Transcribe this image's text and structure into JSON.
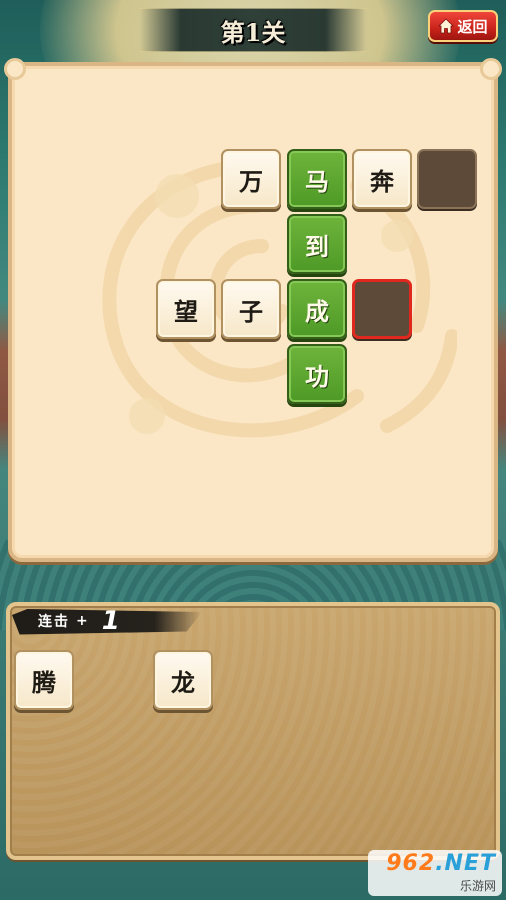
{
  "header": {
    "level_title": "第1关",
    "back_label": "返回"
  },
  "board": {
    "tiles": [
      {
        "char": "万",
        "state": "plain"
      },
      {
        "char": "马",
        "state": "green"
      },
      {
        "char": "奔",
        "state": "plain"
      },
      {
        "char": "",
        "state": "empty"
      },
      {
        "char": "到",
        "state": "green"
      },
      {
        "char": "望",
        "state": "plain"
      },
      {
        "char": "子",
        "state": "plain"
      },
      {
        "char": "成",
        "state": "green"
      },
      {
        "char": "",
        "state": "empty-selected"
      },
      {
        "char": "功",
        "state": "green"
      }
    ]
  },
  "combo": {
    "label": "连击",
    "plus": "+",
    "value": "1"
  },
  "candidates": [
    {
      "char": "腾"
    },
    {
      "char": "龙"
    }
  ],
  "watermark": {
    "brand_prefix": "962",
    "brand_suffix": ".NET",
    "subtitle": "乐游网"
  },
  "colors": {
    "green_tile": "#5ba42f",
    "selected_border": "#e0281f",
    "board_bg": "#fbe6c6",
    "back_button": "#d2271e"
  }
}
